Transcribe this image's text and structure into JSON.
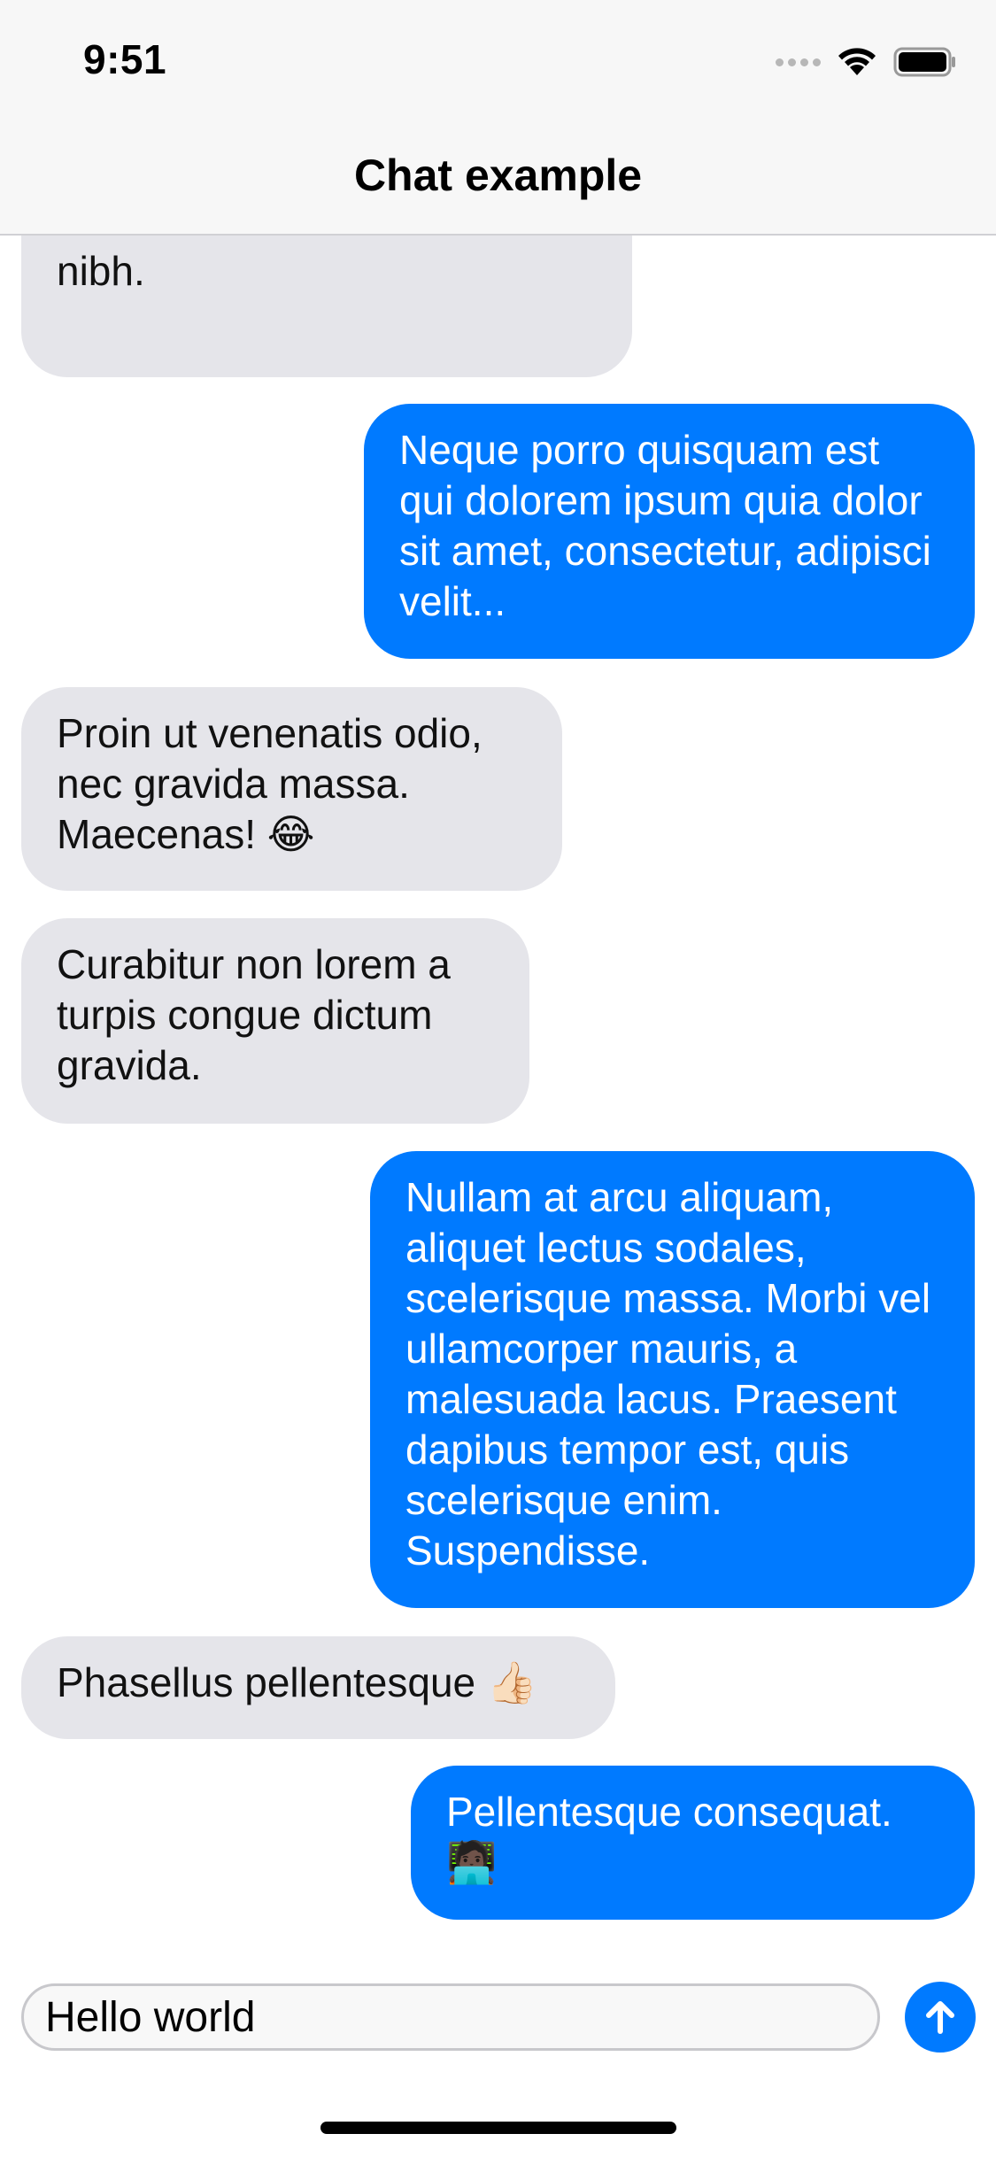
{
  "status_bar": {
    "time": "9:51",
    "icons": [
      "cellular-signal-icon",
      "wifi-icon",
      "battery-icon"
    ]
  },
  "nav": {
    "title": "Chat example"
  },
  "messages": [
    {
      "direction": "incoming",
      "text": "nibh."
    },
    {
      "direction": "outgoing",
      "text": "Neque porro quisquam est qui dolorem ipsum quia dolor sit amet, consectetur, adipisci velit..."
    },
    {
      "direction": "incoming",
      "text": "Proin ut venenatis odio, nec gravida massa. Maecenas! 😂"
    },
    {
      "direction": "incoming",
      "text": "Curabitur non lorem a turpis congue dictum gravida."
    },
    {
      "direction": "outgoing",
      "text": "Nullam at arcu aliquam, aliquet lectus sodales, scelerisque massa. Morbi vel ullamcorper mauris, a malesuada lacus. Praesent dapibus tempor est, quis scelerisque enim. Suspendisse."
    },
    {
      "direction": "incoming",
      "text": "Phasellus pellentesque 👍🏻"
    },
    {
      "direction": "outgoing",
      "text": "Pellentesque consequat. 🧑🏿‍💻"
    }
  ],
  "composer": {
    "value": "Hello world",
    "send_icon": "arrow-up-icon"
  },
  "colors": {
    "outgoing_bubble": "#007aff",
    "incoming_bubble": "#e5e5ea",
    "nav_background": "#f7f7f7"
  }
}
